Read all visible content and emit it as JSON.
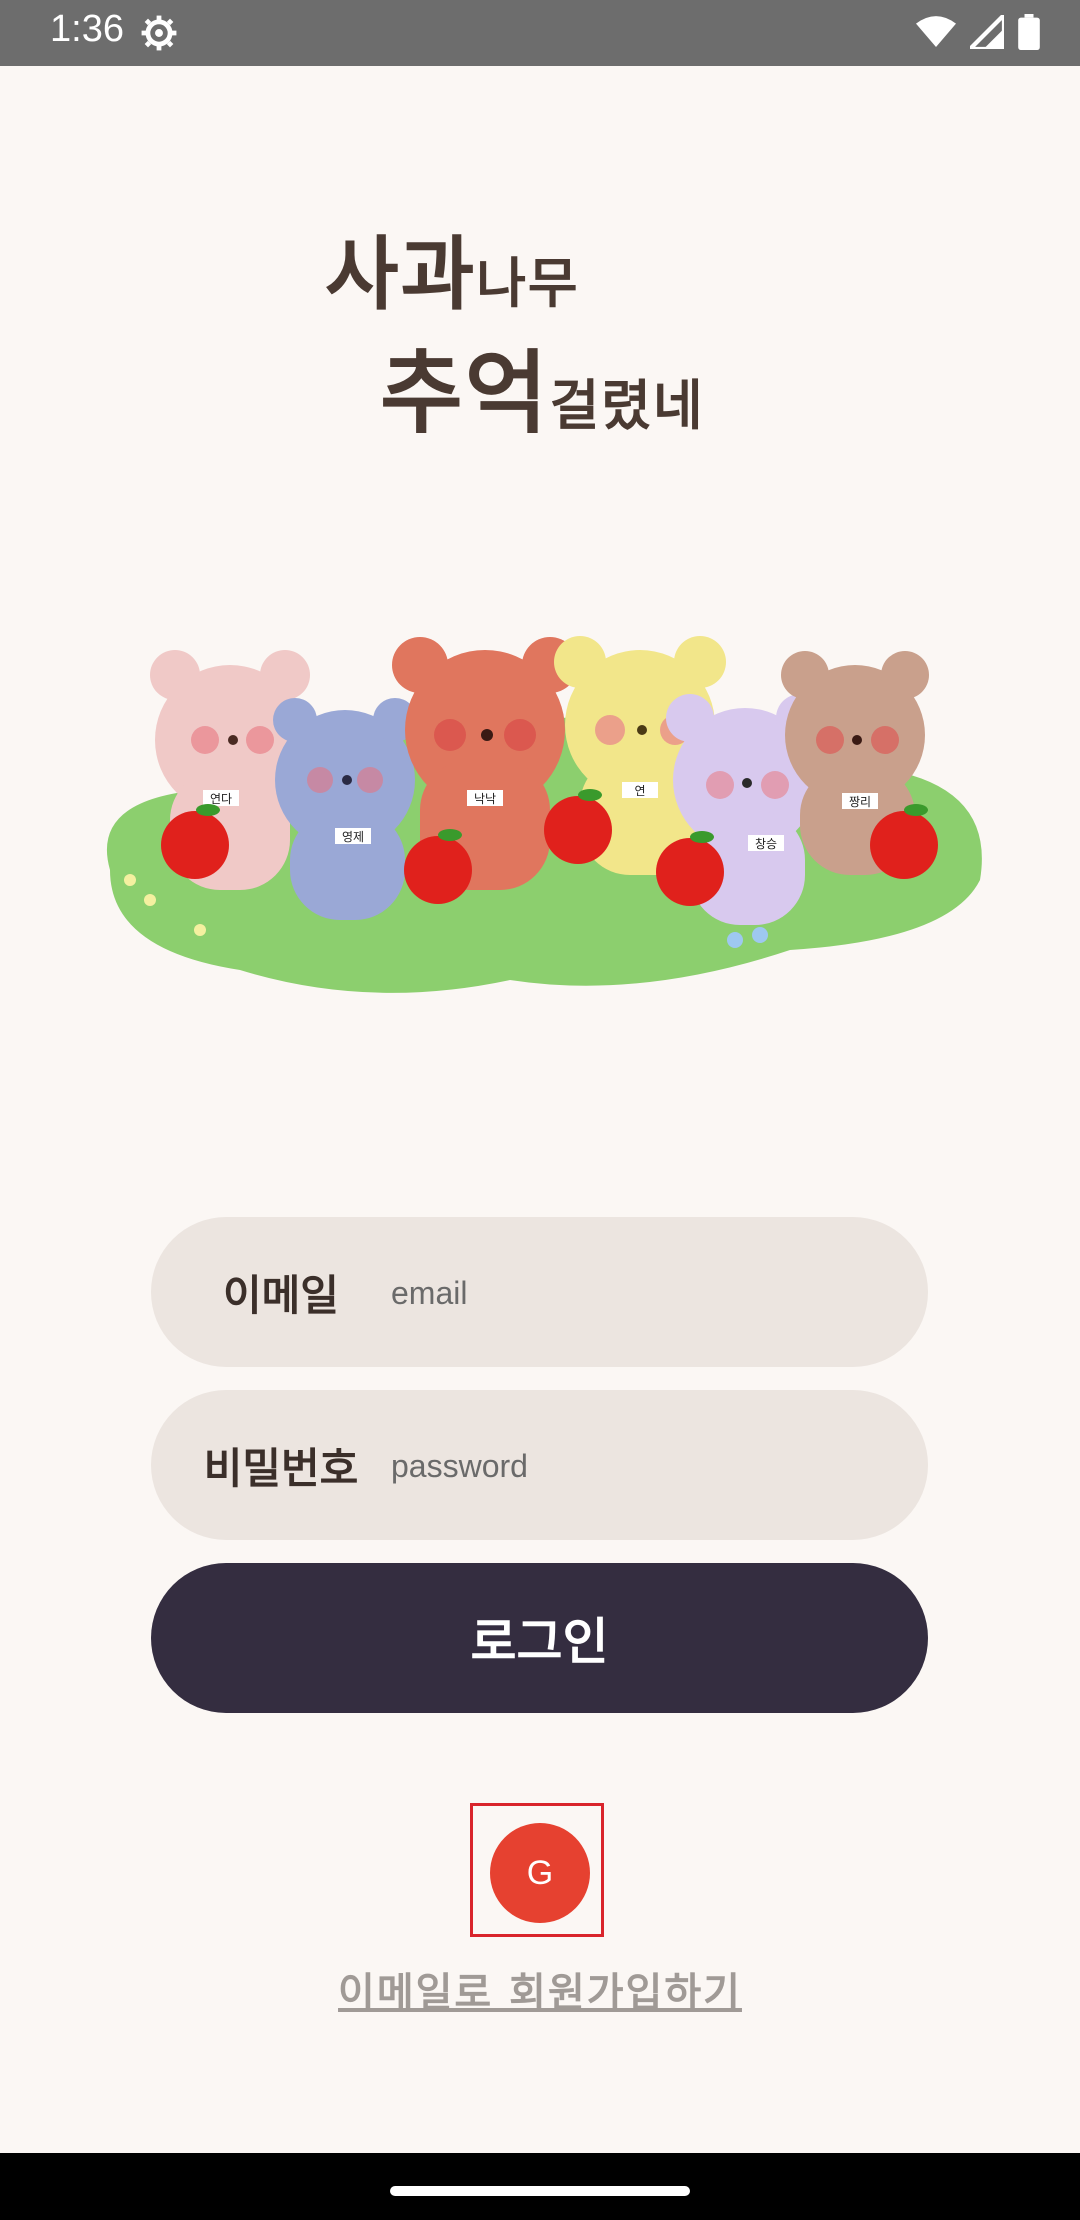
{
  "status_bar": {
    "time": "1:36",
    "icons": [
      "gear-icon",
      "wifi-icon",
      "signal-icon",
      "battery-icon"
    ]
  },
  "title": {
    "line1_big": "사과",
    "line1_small": "나무",
    "line2_big": "추억",
    "line2_small": "걸렸네"
  },
  "illustration": {
    "bears": [
      {
        "name": "연다",
        "color": "#f0c9c7"
      },
      {
        "name": "영제",
        "color": "#9aa8d6"
      },
      {
        "name": "낙낙",
        "color": "#e0765e"
      },
      {
        "name": "연",
        "color": "#f2e68a"
      },
      {
        "name": "창승",
        "color": "#d8c9ee"
      },
      {
        "name": "짱리",
        "color": "#c9a08c"
      }
    ],
    "grass_color": "#8ccf6e",
    "apple_color": "#e0211c"
  },
  "form": {
    "email_label": "이메일",
    "email_placeholder": "email",
    "password_label": "비밀번호",
    "password_placeholder": "password"
  },
  "login_button": "로그인",
  "google_button": "G",
  "signup_link": "이메일로 회원가입하기",
  "colors": {
    "background": "#fbf7f4",
    "field_bg": "#ece5e0",
    "button_bg": "#342d40",
    "google_red": "#e64130"
  }
}
